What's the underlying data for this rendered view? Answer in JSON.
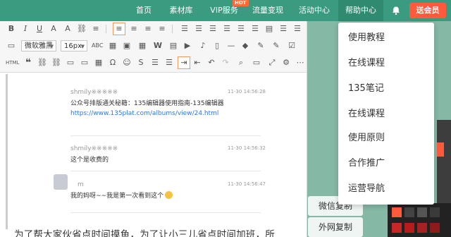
{
  "nav": {
    "items": [
      "首页",
      "素材库",
      "VIP服务",
      "流量变现",
      "活动中心",
      "帮助中心"
    ],
    "hot_badge": "HOT",
    "member_button": "送会员"
  },
  "toolbar": {
    "font_family": "微软雅黑",
    "font_size": "16px"
  },
  "comments": [
    {
      "name": "shmily※※※※※",
      "time": "11-30 14:56:28",
      "text": "公众号排版通关秘籍：135编辑器使用指南-135编辑器 ",
      "link": "https://www.135plat.com/albums/view/24.html"
    },
    {
      "name": "shmily※※※※※",
      "time": "11-30 14:56:32",
      "text": "这个是收费的"
    },
    {
      "name": "m",
      "time": "11-30 14:56:47",
      "text": "我的妈呀~~我是第一次看到这个"
    }
  ],
  "body_paragraph": "为了帮大家伙省点时间摸鱼，为了让小三儿省点时间加班，所",
  "side_buttons": {
    "wechat_copy": "微信复制",
    "external_copy": "外网复制"
  },
  "dropdown": {
    "items": [
      "使用教程",
      "在线课程",
      "135笔记",
      "在线课程",
      "使用原则",
      "合作推广",
      "运营导航"
    ]
  },
  "colors": {
    "nav_bg": "#3a9b80",
    "accent_orange": "#ff5a3c",
    "link": "#2a7ae2"
  }
}
